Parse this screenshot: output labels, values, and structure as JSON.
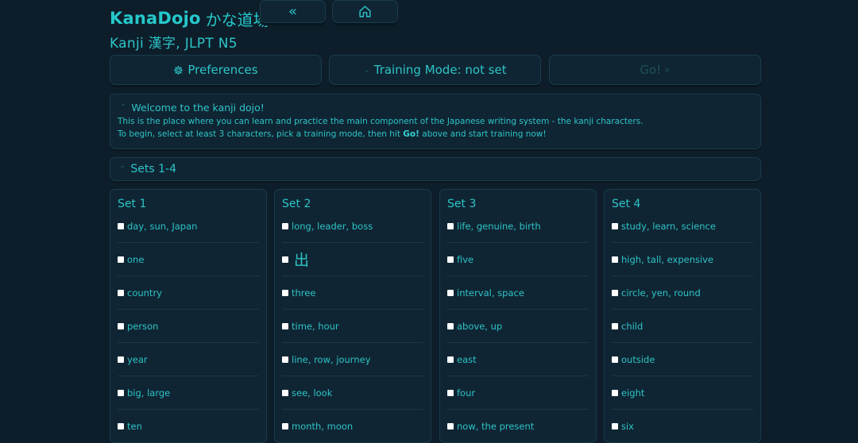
{
  "header": {
    "brand": "KanaDojo",
    "brand_kana": "かな道場",
    "back_icon": "«",
    "home_icon": "home-icon",
    "subtitle": "Kanji 漢字, JLPT N5"
  },
  "actions": {
    "preferences": "Preferences",
    "training_mode": "Training Mode: not set",
    "go": "Go!",
    "go_icon": "»"
  },
  "welcome": {
    "title": "Welcome to the kanji dojo!",
    "line1": "This is the place where you can learn and practice the main component of the Japanese writing system - the kanji characters.",
    "line2_pre": "To begin, select at least 3 characters, pick a training mode, then hit ",
    "line2_go": "Go!",
    "line2_post": " above and start training now!"
  },
  "sets_header": "Sets 1-4",
  "sets": [
    {
      "title": "Set 1",
      "items": [
        "day, sun, Japan",
        "one",
        "country",
        "person",
        "year",
        "big, large",
        "ten"
      ]
    },
    {
      "title": "Set 2",
      "items": [
        "long, leader, boss",
        "出",
        "three",
        "time, hour",
        "line, row, journey",
        "see, look",
        "month, moon"
      ]
    },
    {
      "title": "Set 3",
      "items": [
        "life, genuine, birth",
        "five",
        "interval, space",
        "above, up",
        "east",
        "four",
        "now, the present"
      ]
    },
    {
      "title": "Set 4",
      "items": [
        "study, learn, science",
        "high, tall, expensive",
        "circle, yen, round",
        "child",
        "outside",
        "eight",
        "six"
      ]
    }
  ],
  "colors": {
    "background": "#0d1e2a",
    "panel": "#0f2533",
    "accent": "#2ec4c7",
    "border": "#1a3b4c"
  }
}
